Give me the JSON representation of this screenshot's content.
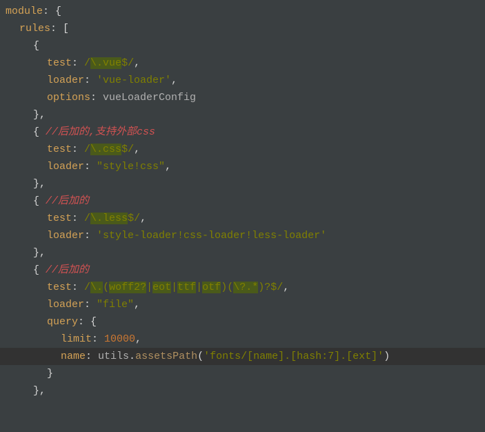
{
  "code": {
    "module_key": "module",
    "rules_key": "rules",
    "test_key": "test",
    "loader_key": "loader",
    "options_key": "options",
    "query_key": "query",
    "limit_key": "limit",
    "name_key": "name",
    "rule1": {
      "regex_prefix": "/",
      "regex_body": "\\.vue",
      "regex_suffix": "$/",
      "loader_val": "'vue-loader'",
      "options_val": "vueLoaderConfig"
    },
    "rule2": {
      "comment": "//后加的,支持外部css",
      "regex_prefix": "/",
      "regex_body": "\\.css",
      "regex_suffix": "$/",
      "loader_val": "\"style!css\""
    },
    "rule3": {
      "comment": "//后加的",
      "regex_prefix": "/",
      "regex_body": "\\.less",
      "regex_suffix": "$/",
      "loader_val": "'style-loader!css-loader!less-loader'"
    },
    "rule4": {
      "comment": "//后加的",
      "regex_prefix": "/",
      "regex_body1": "\\.",
      "regex_paren1": "(",
      "regex_alt1": "woff2?",
      "regex_pipe": "|",
      "regex_alt2": "eot",
      "regex_alt3": "ttf",
      "regex_alt4": "otf",
      "regex_paren2": ")(",
      "regex_body2": "\\?.*",
      "regex_paren3": ")?",
      "regex_suffix": "$/",
      "loader_val": "\"file\"",
      "limit_val": "10000",
      "name_obj": "utils",
      "name_method": "assetsPath",
      "name_arg": "'fonts/[name].[hash:7].[ext]'"
    }
  }
}
